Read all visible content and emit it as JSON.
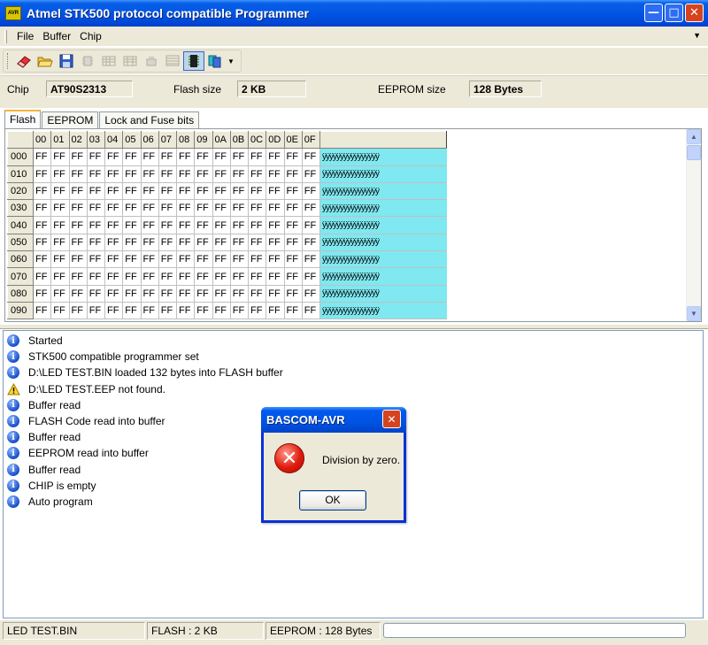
{
  "window": {
    "title": "Atmel STK500 protocol compatible Programmer",
    "icon_text": "AVR"
  },
  "menu": {
    "items": [
      "File",
      "Buffer",
      "Chip"
    ]
  },
  "chip_info": {
    "chip_label": "Chip",
    "chip_value": "AT90S2313",
    "flash_label": "Flash size",
    "flash_value": "2 KB",
    "eeprom_label": "EEPROM size",
    "eeprom_value": "128 Bytes"
  },
  "tabs": [
    {
      "label": "Flash",
      "active": true
    },
    {
      "label": "EEPROM",
      "active": false
    },
    {
      "label": "Lock and Fuse bits",
      "active": false
    }
  ],
  "hex_grid": {
    "columns": [
      "00",
      "01",
      "02",
      "03",
      "04",
      "05",
      "06",
      "07",
      "08",
      "09",
      "0A",
      "0B",
      "0C",
      "0D",
      "0E",
      "0F"
    ],
    "rows": [
      "000",
      "010",
      "020",
      "030",
      "040",
      "050",
      "060",
      "070",
      "080",
      "090"
    ],
    "cell_value": "FF",
    "ascii_value": "ÿÿÿÿÿÿÿÿÿÿÿÿÿÿÿÿ"
  },
  "log": [
    {
      "type": "info",
      "text": "Started"
    },
    {
      "type": "info",
      "text": "STK500 compatible programmer set"
    },
    {
      "type": "info",
      "text": "D:\\LED TEST.BIN loaded 132 bytes into FLASH buffer"
    },
    {
      "type": "warning",
      "text": "D:\\LED TEST.EEP not found."
    },
    {
      "type": "info",
      "text": "Buffer read"
    },
    {
      "type": "info",
      "text": "FLASH Code read into buffer"
    },
    {
      "type": "info",
      "text": "Buffer read"
    },
    {
      "type": "info",
      "text": "EEPROM read into buffer"
    },
    {
      "type": "info",
      "text": "Buffer read"
    },
    {
      "type": "info",
      "text": "CHIP is empty"
    },
    {
      "type": "info",
      "text": "Auto program"
    }
  ],
  "status": {
    "file": "LED TEST.BIN",
    "flash": "FLASH : 2 KB",
    "eeprom": "EEPROM : 128 Bytes"
  },
  "dialog": {
    "title": "BASCOM-AVR",
    "message": "Division by zero.",
    "ok_label": "OK"
  }
}
